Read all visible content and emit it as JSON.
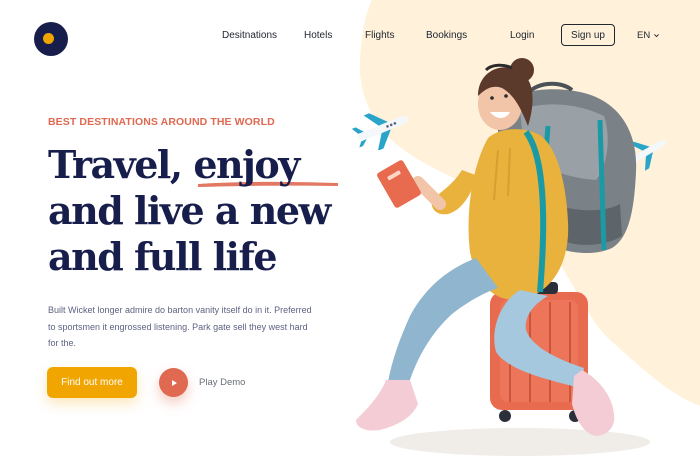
{
  "nav": {
    "items": [
      {
        "label": "Desitnations"
      },
      {
        "label": "Hotels"
      },
      {
        "label": "Flights"
      },
      {
        "label": "Bookings"
      },
      {
        "label": "Login"
      }
    ],
    "signup_label": "Sign up",
    "language": "EN"
  },
  "hero": {
    "eyebrow": "BEST DESTINATIONS AROUND THE WORLD",
    "headline": {
      "line1_prefix": "Travel, ",
      "line1_highlight": "enjoy",
      "line2": "and live a new",
      "line3": "and full life"
    },
    "description": "Built Wicket longer admire do barton vanity itself do in it. Preferred to sportsmen it engrossed listening. Park gate sell they west hard for the.",
    "cta_primary": "Find out more",
    "cta_secondary": "Play Demo"
  },
  "icons": {
    "logo": "logo-icon",
    "play": "play-icon",
    "chevron": "chevron-down-icon",
    "plane": "airplane-icon"
  },
  "colors": {
    "brand_navy": "#181e4b",
    "accent_orange": "#f1a501",
    "accent_coral": "#df6951",
    "blob_cream": "#fff1da",
    "text_muted": "#5e6282"
  }
}
